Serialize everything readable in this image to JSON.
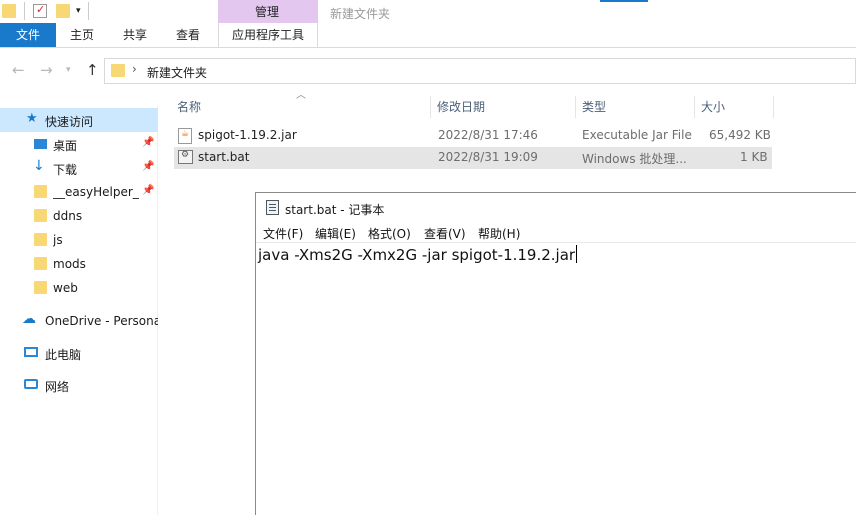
{
  "explorer": {
    "window_title": "新建文件夹",
    "context_tab": "管理",
    "ribbon_tabs": [
      "文件",
      "主页",
      "共享",
      "查看",
      "应用程序工具"
    ],
    "address_path": "新建文件夹",
    "sidebar": {
      "quick_access": "快速访问",
      "items": [
        "桌面",
        "下载",
        "__easyHelper__",
        "ddns",
        "js",
        "mods",
        "web"
      ],
      "onedrive": "OneDrive - Persona",
      "this_pc": "此电脑",
      "network": "网络"
    },
    "columns": [
      "名称",
      "修改日期",
      "类型",
      "大小"
    ],
    "files": [
      {
        "name": "spigot-1.19.2.jar",
        "date": "2022/8/31 17:46",
        "type": "Executable Jar File",
        "size": "65,492 KB"
      },
      {
        "name": "start.bat",
        "date": "2022/8/31 19:09",
        "type": "Windows 批处理...",
        "size": "1 KB"
      }
    ]
  },
  "notepad": {
    "title": "start.bat - 记事本",
    "menu": [
      "文件(F)",
      "编辑(E)",
      "格式(O)",
      "查看(V)",
      "帮助(H)"
    ],
    "content": "java -Xms2G -Xmx2G -jar spigot-1.19.2.jar"
  },
  "colors": {
    "accent": "#1979ca",
    "manage_tab": "#e3c7ee",
    "selection": "#e5e5e5",
    "folder": "#f8d775"
  }
}
